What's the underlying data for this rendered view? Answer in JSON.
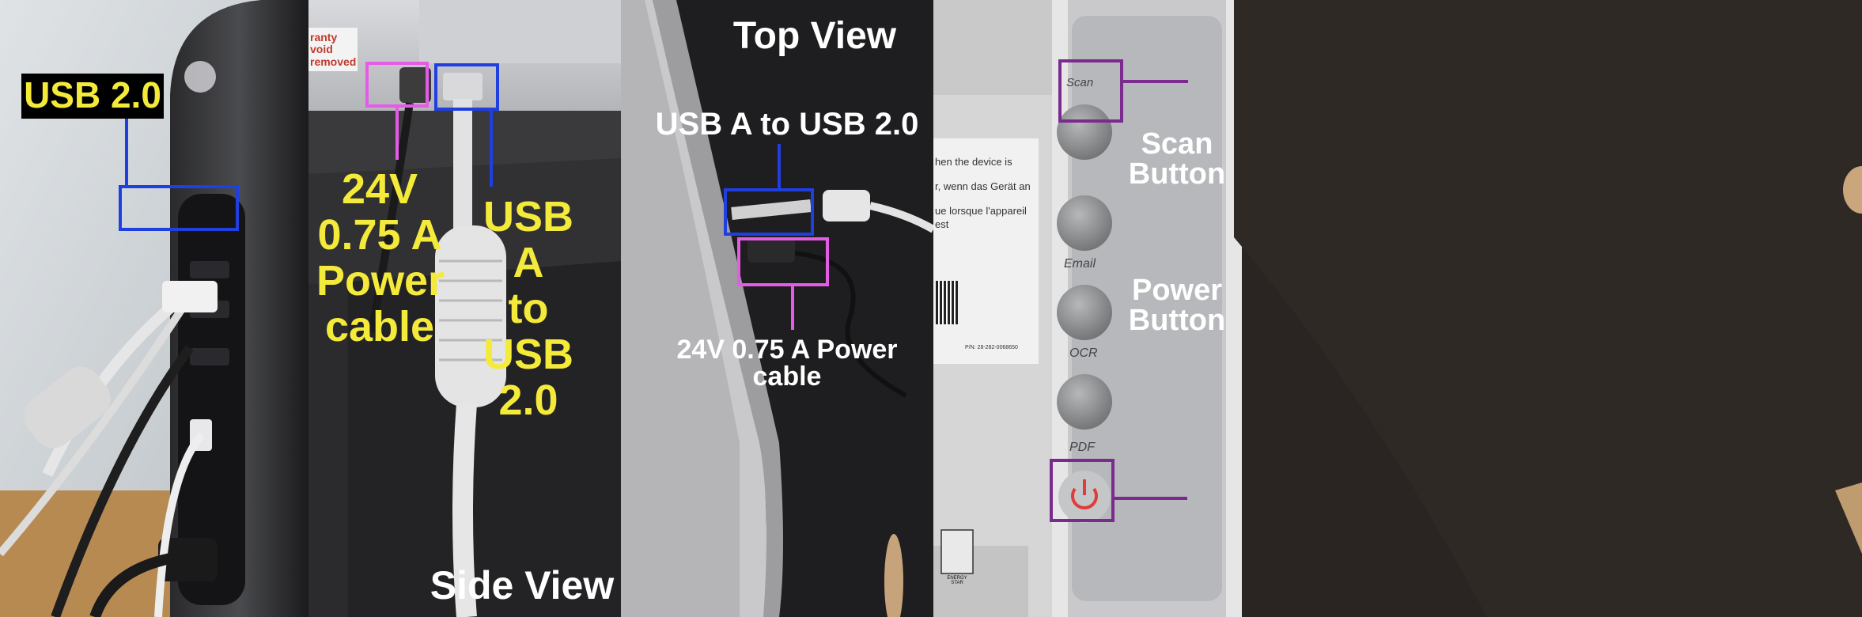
{
  "panel1": {
    "usb_label": "USB 2.0"
  },
  "panel2": {
    "warranty_text": "ranty void removed",
    "power_label_lines": [
      "24V",
      "0.75 A",
      "Power",
      "cable"
    ],
    "usb_label_lines": [
      "USB A",
      "to",
      "USB",
      "2.0"
    ],
    "view_label": "Side View"
  },
  "panel3": {
    "view_label": "Top View",
    "usb_label": "USB A to USB 2.0",
    "power_label": "24V 0.75 A Power cable"
  },
  "panel4": {
    "sticker_lines": [
      "hen the device is",
      "r, wenn das Gerät an",
      "ue lorsque l'appareil est",
      "P/N: 28-282-0068650"
    ],
    "button_labels": [
      "Scan",
      "Email",
      "OCR",
      "PDF"
    ],
    "scan_button_lines": [
      "Scan",
      "Button"
    ],
    "power_button_lines": [
      "Power",
      "Button"
    ],
    "energy_star_text": "ENERGY STAR"
  },
  "colors": {
    "label_yellow": "#f4ea3a",
    "box_blue": "#1f3fe0",
    "box_pink": "#e45ce6",
    "box_purple": "#7b2a8e",
    "white": "#ffffff"
  }
}
